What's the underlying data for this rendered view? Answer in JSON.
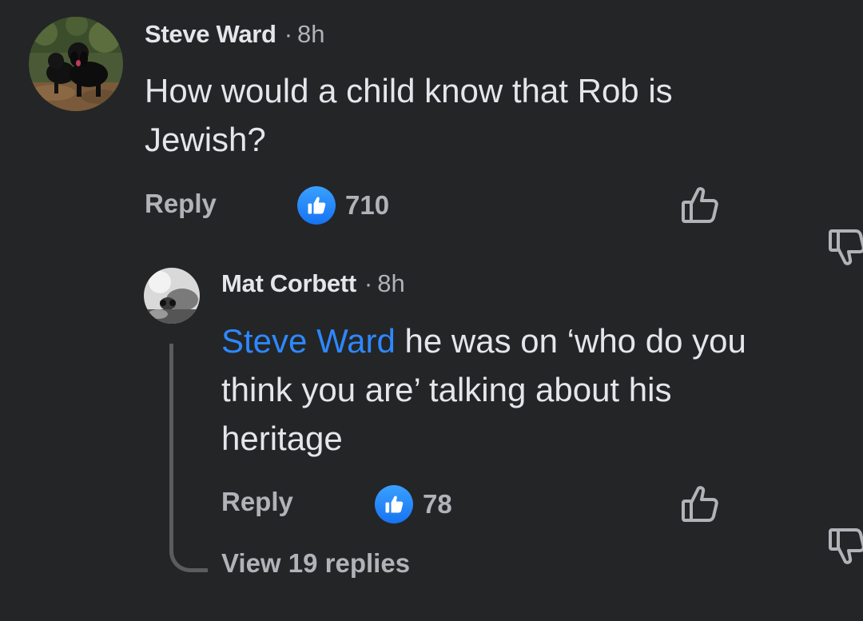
{
  "comments": [
    {
      "author": "Steve Ward",
      "separator": "·",
      "time": "8h",
      "text_line1": "How would a child know that Rob is",
      "text_line2": "Jewish?",
      "reply_label": "Reply",
      "like_count": "710"
    }
  ],
  "reply": {
    "author": "Mat Corbett",
    "separator": "·",
    "time": "8h",
    "mention": "Steve Ward",
    "text_line1": " he was on ‘who do you",
    "text_line2": "think you are’ talking about his",
    "text_line3": "heritage",
    "reply_label": "Reply",
    "like_count": "78"
  },
  "view_replies": "View 19 replies",
  "icons": {
    "like_badge": "thumbs-up-icon",
    "upvote": "thumbs-up-outline-icon",
    "downvote": "thumbs-down-outline-icon"
  },
  "colors": {
    "background": "#242526",
    "text": "#e4e6eb",
    "secondary_text": "#b0b3b8",
    "mention": "#2d88ff",
    "like_badge": "#1673f2"
  }
}
